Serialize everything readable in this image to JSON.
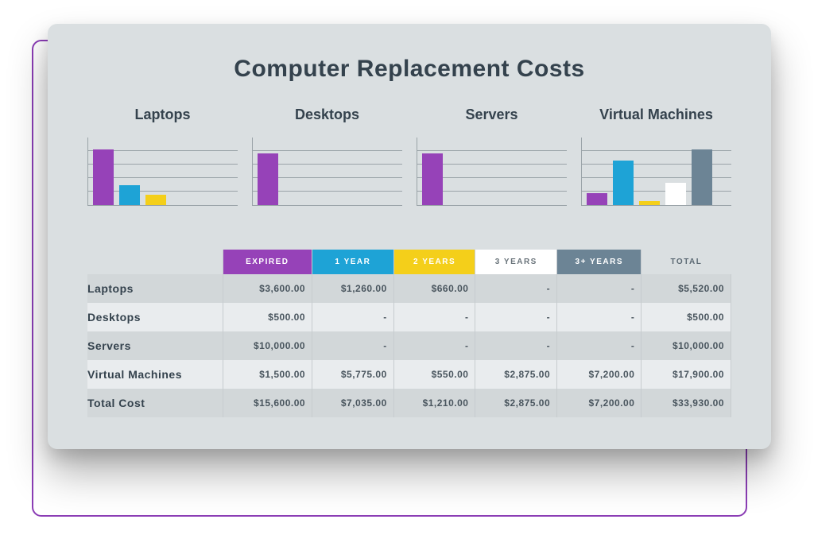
{
  "title": "Computer Replacement Costs",
  "legend": {
    "expired": "EXPIRED",
    "year1": "1 YEAR",
    "year2": "2 YEARS",
    "year3": "3 YEARS",
    "year3p": "3+ YEARS",
    "total": "TOTAL"
  },
  "colors": {
    "expired": "#9642b8",
    "year1": "#1ea3d6",
    "year2": "#f4cf1a",
    "year3": "#ffffff",
    "year3p": "#6c8495"
  },
  "chart_data": [
    {
      "type": "bar",
      "title": "Laptops",
      "categories": [
        "Expired",
        "1 Year",
        "2 Years",
        "3 Years",
        "3+ Years"
      ],
      "values": [
        3600,
        1260,
        660,
        0,
        0
      ],
      "ylabel": "",
      "xlabel": "",
      "ylim": [
        0,
        4000
      ]
    },
    {
      "type": "bar",
      "title": "Desktops",
      "categories": [
        "Expired",
        "1 Year",
        "2 Years",
        "3 Years",
        "3+ Years"
      ],
      "values": [
        500,
        0,
        0,
        0,
        0
      ],
      "ylabel": "",
      "xlabel": "",
      "ylim": [
        0,
        600
      ]
    },
    {
      "type": "bar",
      "title": "Servers",
      "categories": [
        "Expired",
        "1 Year",
        "2 Years",
        "3 Years",
        "3+ Years"
      ],
      "values": [
        10000,
        0,
        0,
        0,
        0
      ],
      "ylabel": "",
      "xlabel": "",
      "ylim": [
        0,
        12000
      ]
    },
    {
      "type": "bar",
      "title": "Virtual Machines",
      "categories": [
        "Expired",
        "1 Year",
        "2 Years",
        "3 Years",
        "3+ Years"
      ],
      "values": [
        1500,
        5775,
        550,
        2875,
        7200
      ],
      "ylabel": "",
      "xlabel": "",
      "ylim": [
        0,
        8000
      ]
    }
  ],
  "table": {
    "rows": [
      {
        "label": "Laptops",
        "cells": [
          "$3,600.00",
          "$1,260.00",
          "$660.00",
          "-",
          "-",
          "$5,520.00"
        ]
      },
      {
        "label": "Desktops",
        "cells": [
          "$500.00",
          "-",
          "-",
          "-",
          "-",
          "$500.00"
        ]
      },
      {
        "label": "Servers",
        "cells": [
          "$10,000.00",
          "-",
          "-",
          "-",
          "-",
          "$10,000.00"
        ]
      },
      {
        "label": "Virtual Machines",
        "cells": [
          "$1,500.00",
          "$5,775.00",
          "$550.00",
          "$2,875.00",
          "$7,200.00",
          "$17,900.00"
        ]
      },
      {
        "label": "Total Cost",
        "cells": [
          "$15,600.00",
          "$7,035.00",
          "$1,210.00",
          "$2,875.00",
          "$7,200.00",
          "$33,930.00"
        ]
      }
    ]
  }
}
